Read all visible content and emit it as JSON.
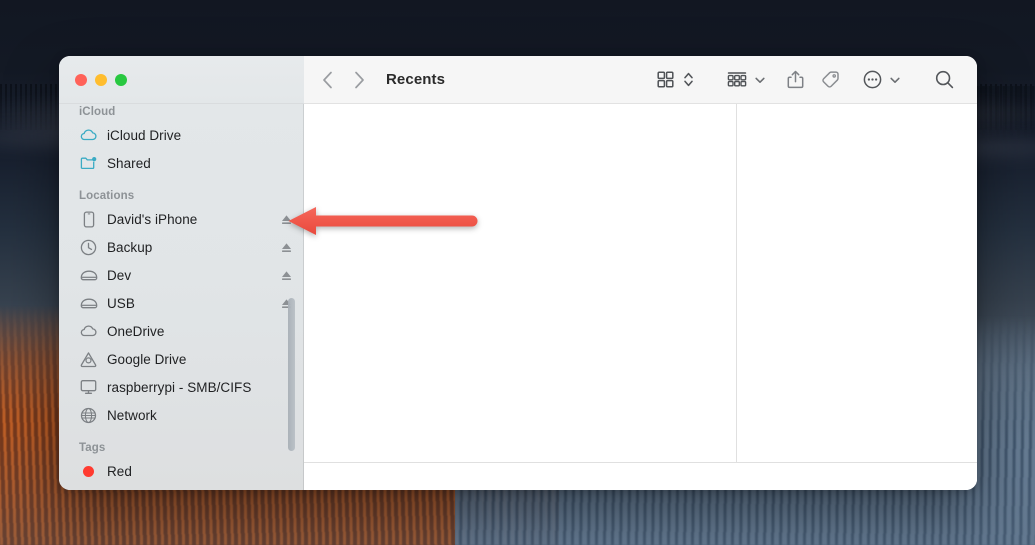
{
  "window": {
    "title": "Recents",
    "traffic_lights": [
      {
        "name": "close",
        "color": "#ff6259"
      },
      {
        "name": "minimize",
        "color": "#ffbd2e"
      },
      {
        "name": "zoom",
        "color": "#28c840"
      }
    ]
  },
  "toolbar": {
    "back_icon": "chevron-left-icon",
    "forward_icon": "chevron-right-icon",
    "view_icon": "icon-view-grid-icon",
    "view_chevron_icon": "chevron-up-down-icon",
    "group_icon": "group-by-icon",
    "group_chevron_icon": "chevron-down-icon",
    "share_icon": "share-icon",
    "tag_icon": "tag-icon",
    "more_icon": "more-ellipsis-circle-icon",
    "more_chevron_icon": "chevron-down-icon",
    "search_icon": "search-icon"
  },
  "sidebar": {
    "sections": [
      {
        "header": "iCloud",
        "items": [
          {
            "label": "iCloud Drive",
            "icon": "cloud-icon",
            "icon_color": "#3aabc4",
            "eject": false
          },
          {
            "label": "Shared",
            "icon": "shared-folder-icon",
            "icon_color": "#3aabc4",
            "eject": false
          }
        ]
      },
      {
        "header": "Locations",
        "items": [
          {
            "label": "David's iPhone",
            "icon": "iphone-icon",
            "icon_color": "#7c8084",
            "eject": true
          },
          {
            "label": "Backup",
            "icon": "clock-icon",
            "icon_color": "#7c8084",
            "eject": true
          },
          {
            "label": "Dev",
            "icon": "external-drive-icon",
            "icon_color": "#7c8084",
            "eject": true
          },
          {
            "label": "USB",
            "icon": "external-drive-icon",
            "icon_color": "#7c8084",
            "eject": true
          },
          {
            "label": "OneDrive",
            "icon": "cloud-icon",
            "icon_color": "#7c8084",
            "eject": false
          },
          {
            "label": "Google Drive",
            "icon": "google-drive-icon",
            "icon_color": "#7c8084",
            "eject": false
          },
          {
            "label": "raspberrypi - SMB/CIFS",
            "icon": "monitor-icon",
            "icon_color": "#7c8084",
            "eject": false
          },
          {
            "label": "Network",
            "icon": "globe-icon",
            "icon_color": "#7c8084",
            "eject": false
          }
        ]
      },
      {
        "header": "Tags",
        "items": [
          {
            "label": "Red",
            "icon": "tag-dot-icon",
            "icon_color": "#ff3b30",
            "eject": false
          }
        ]
      }
    ],
    "eject_icon": "eject-icon",
    "scrollbar": "vertical-scrollbar"
  },
  "annotation": {
    "arrow_color": "#f0574a",
    "arrow_direction": "left",
    "points_at": "David's iPhone eject button"
  }
}
